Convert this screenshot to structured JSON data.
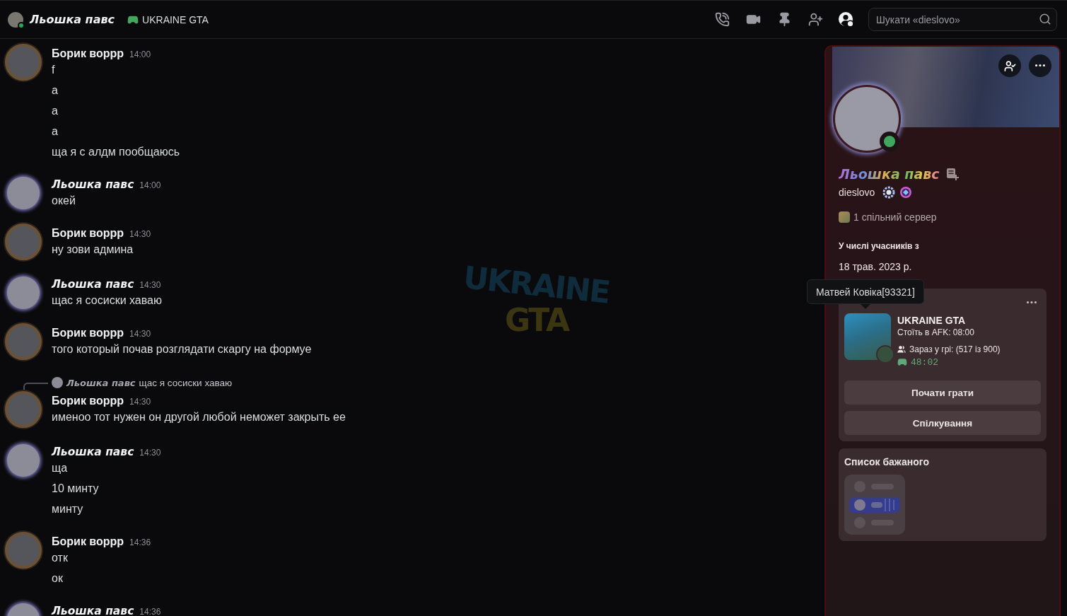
{
  "header": {
    "user": {
      "name": "Льошка павс",
      "online": true
    },
    "activity": "UKRAINE GTA",
    "toolbar": [
      {
        "kind": "call",
        "selected": false
      },
      {
        "kind": "video",
        "selected": false
      },
      {
        "kind": "pin",
        "selected": false
      },
      {
        "kind": "add-member",
        "selected": false
      },
      {
        "kind": "profile",
        "selected": true
      }
    ],
    "search": {
      "placeholder": "Шукати «dieslovo»"
    }
  },
  "background_logo": {
    "line_1": "UKRAINE",
    "line_2": "GTA"
  },
  "messages": [
    {
      "author": "Борик воррр",
      "kind": "framed",
      "time": "14:00",
      "lines": [
        "f",
        "а",
        "а",
        "а",
        "ща я с алдм пообщаюсь"
      ]
    },
    {
      "author": "Льошка павс",
      "kind": "glow",
      "time": "14:00",
      "lines": [
        "окей"
      ]
    },
    {
      "author": "Борик воррр",
      "kind": "framed",
      "time": "14:30",
      "lines": [
        "ну зови админа"
      ]
    },
    {
      "author": "Льошка павс",
      "kind": "glow",
      "time": "14:30",
      "lines": [
        "щас я сосиски хаваю"
      ]
    },
    {
      "author": "Борик воррр",
      "kind": "framed",
      "time": "14:30",
      "lines": [
        "того который почав розглядати скаргу на формуе"
      ]
    },
    {
      "author": "Борик воррр",
      "kind": "framed",
      "time": "14:30",
      "reply": {
        "author": "Льошка павс",
        "text": "щас я сосиски хаваю"
      },
      "lines": [
        "именоо тот нужен он другой любой неможет закрыть ее"
      ]
    },
    {
      "author": "Льошка павс",
      "kind": "glow",
      "time": "14:30",
      "lines": [
        "ща",
        "10 минту",
        "минту"
      ]
    },
    {
      "author": "Борик воррр",
      "kind": "framed",
      "time": "14:36",
      "lines": [
        "отк",
        "ок"
      ]
    },
    {
      "author": "Льошка павс",
      "kind": "glow",
      "time": "14:36"
    }
  ],
  "profile": {
    "name": "Льошка павс",
    "online": true,
    "username": "dieslovo",
    "mutual_servers": "1 спільний сервер",
    "member_since_label": "У числі учасників з",
    "member_since": "18 трав. 2023 р.",
    "activity": {
      "title": "UKRAINE GTA",
      "state": "Стоїть в AFK: 08:00",
      "party": "Зараз у грі: (517 із 900)",
      "elapsed": "48:02"
    },
    "buttons": [
      "Почати грати",
      "Спілкування"
    ],
    "wishlist": {
      "title": "Список бажаного"
    }
  },
  "tooltip": {
    "text": "Матвей Ковіка[93321]"
  }
}
